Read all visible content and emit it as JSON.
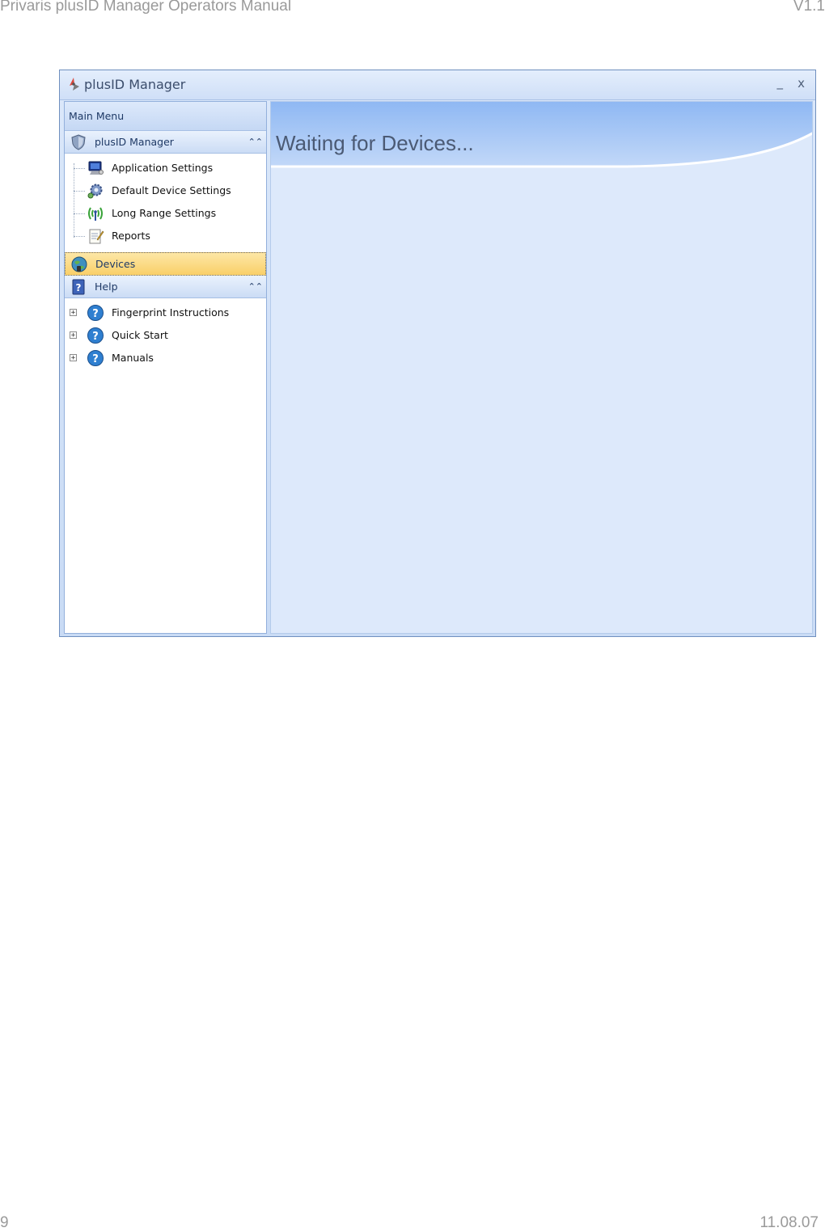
{
  "page": {
    "header_title": "Privaris plusID Manager Operators Manual",
    "header_version": "V1.1",
    "footer_page": "9",
    "footer_date": "11.08.07"
  },
  "window": {
    "title": "plusID Manager",
    "minimize_label": "_",
    "close_label": "x"
  },
  "sidebar": {
    "title": "Main Menu",
    "groups": [
      {
        "label": "plusID Manager",
        "icon": "shield-icon",
        "items": [
          {
            "label": "Application Settings",
            "icon": "monitor-icon"
          },
          {
            "label": "Default Device Settings",
            "icon": "gear-icon"
          },
          {
            "label": "Long Range Settings",
            "icon": "antenna-icon"
          },
          {
            "label": "Reports",
            "icon": "notepad-icon"
          }
        ]
      },
      {
        "label": "Devices",
        "icon": "globe-icon",
        "selected": true
      },
      {
        "label": "Help",
        "icon": "help-book-icon",
        "items": [
          {
            "label": "Fingerprint Instructions",
            "icon": "question-icon"
          },
          {
            "label": "Quick Start",
            "icon": "question-icon"
          },
          {
            "label": "Manuals",
            "icon": "question-icon"
          }
        ]
      }
    ]
  },
  "content": {
    "heading": "Waiting for Devices..."
  },
  "colors": {
    "selected_group": "#f9cf68",
    "panel_bg": "#dde9fb",
    "accent_blue": "#a8c8f7"
  }
}
